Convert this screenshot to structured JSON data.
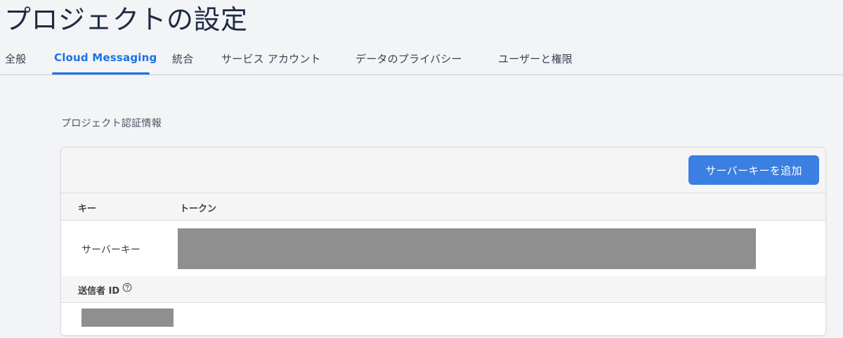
{
  "page": {
    "title": "プロジェクトの設定"
  },
  "tabs": [
    {
      "label": "全般",
      "active": false
    },
    {
      "label": "Cloud Messaging",
      "active": true
    },
    {
      "label": "統合",
      "active": false
    },
    {
      "label": "サービス アカウント",
      "active": false
    },
    {
      "label": "データのプライバシー",
      "active": false
    },
    {
      "label": "ユーザーと権限",
      "active": false
    }
  ],
  "credentials": {
    "section_title": "プロジェクト認証情報",
    "add_button_label": "サーバーキーを追加",
    "columns": {
      "key": "キー",
      "token": "トークン"
    },
    "rows": [
      {
        "key": "サーバーキー",
        "token_redacted": true
      }
    ],
    "sender_id": {
      "label": "送信者 ID",
      "help_icon": "help-circle-icon",
      "value_redacted": true
    }
  },
  "colors": {
    "accent": "#1a73e8",
    "button": "#3a7fe1",
    "redaction": "#8f8f8f",
    "background": "#f3f4f6"
  }
}
